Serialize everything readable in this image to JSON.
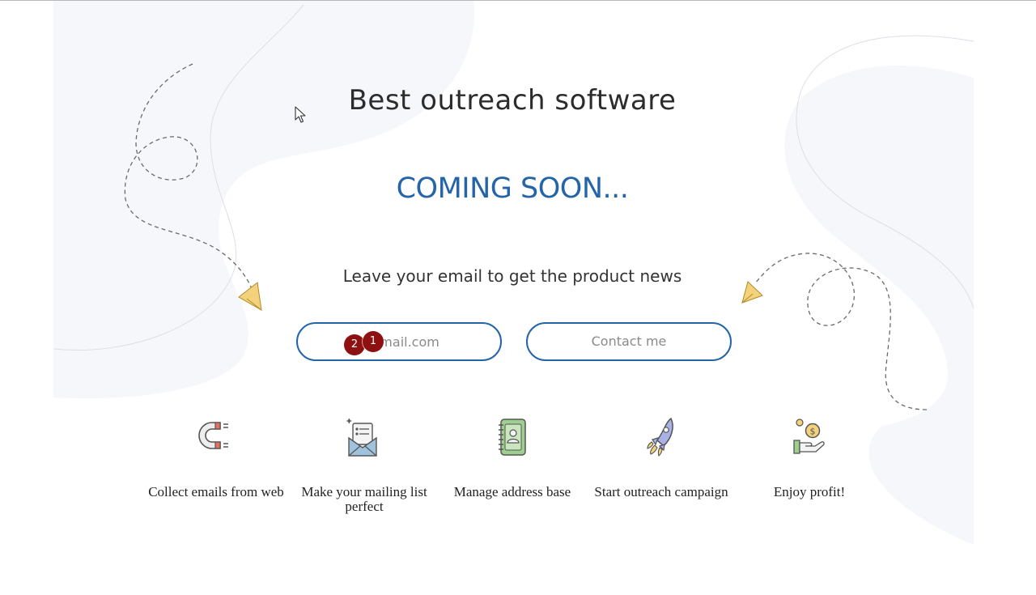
{
  "page": {
    "title": "Best outreach software",
    "coming_soon": "COMING SOON...",
    "subtitle": "Leave your email to get the product news"
  },
  "form": {
    "email_placeholder": "@gmail.com",
    "contact_label": "Contact me"
  },
  "annotations": [
    {
      "label": "1"
    },
    {
      "label": "2"
    }
  ],
  "features": [
    {
      "icon": "magnet-icon",
      "label": "Collect emails from web"
    },
    {
      "icon": "mail-list-icon",
      "label": "Make your mailing list perfect"
    },
    {
      "icon": "address-book-icon",
      "label": "Manage address base"
    },
    {
      "icon": "rocket-icon",
      "label": "Start outreach campaign"
    },
    {
      "icon": "profit-icon",
      "label": "Enjoy profit!"
    }
  ],
  "colors": {
    "accent": "#2464a8",
    "title_text": "#2c2c2c",
    "badge": "#8f1010",
    "background_shape": "#f6f7fb"
  }
}
